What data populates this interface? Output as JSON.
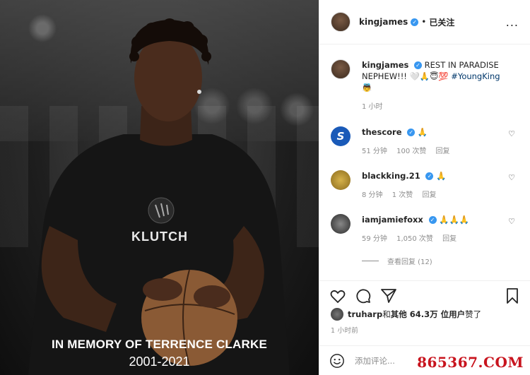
{
  "post": {
    "image_caption_line1": "IN MEMORY OF TERRENCE CLARKE",
    "image_caption_line2": "2001-2021",
    "shirt_logo": "KLUTCH"
  },
  "header": {
    "username": "kingjames",
    "separator": "•",
    "follow_status": "已关注",
    "more": "..."
  },
  "caption": {
    "username": "kingjames",
    "text": "REST IN PARADISE NEPHEW!!! 🤍🙏😇💯",
    "hashtag": "#YoungKing",
    "emoji_line": "👼",
    "time": "1 小时"
  },
  "comments": [
    {
      "username": "thescore",
      "text": "🙏",
      "time": "51 分钟",
      "likes": "100 次赞",
      "reply": "回复",
      "avatar_letter": "S"
    },
    {
      "username": "blackking.21",
      "text": "🙏",
      "time": "8 分钟",
      "likes": "1 次赞",
      "reply": "回复"
    },
    {
      "username": "iamjamiefoxx",
      "text": "🙏🙏🙏",
      "time": "59 分钟",
      "likes": "1,050 次赞",
      "reply": "回复"
    }
  ],
  "view_replies": "查看回复 (12)",
  "likes_line": {
    "liker": "truharp",
    "rest": " 和 ",
    "others": "其他 64.3万 位用户",
    "suffix": " 赞了"
  },
  "post_time": "1 小时前",
  "add_comment": {
    "placeholder": "添加评论..."
  },
  "watermark": "865367.COM",
  "colors": {
    "verified": "#3897f0",
    "hashtag": "#00376b",
    "muted": "#8e8e8e",
    "watermark": "#c8141e"
  }
}
